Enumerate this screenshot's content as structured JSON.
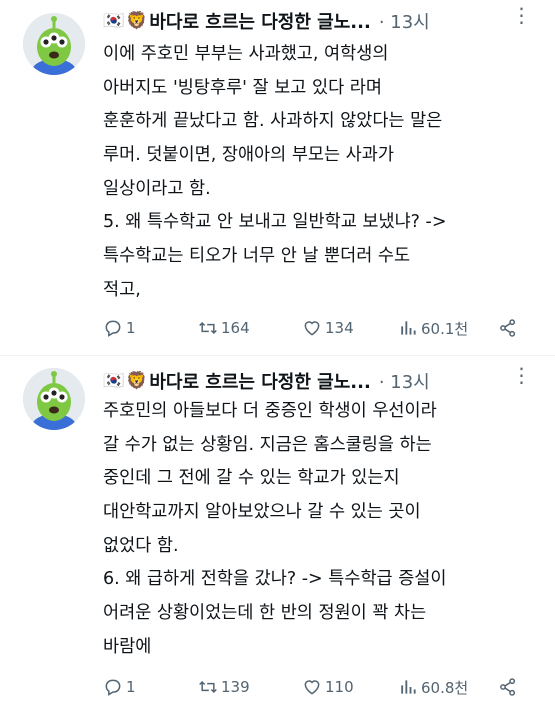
{
  "tweets": [
    {
      "author_flag": "🇰🇷",
      "author_emoji": "🦁",
      "author_name": "바다로 흐르는 다정한 글노...",
      "time": "· 13시",
      "lines": [
        "이에 주호민 부부는 사과했고, 여학생의",
        "아버지도 '빙탕후루' 잘 보고 있다 라며",
        "훈훈하게 끝났다고 함. 사과하지 않았다는 말은",
        "루머. 덧붙이면, 장애아의 부모는 사과가",
        "일상이라고 함.",
        "5. 왜 특수학교 안 보내고 일반학교 보냈냐? ->",
        "특수학교는 티오가 너무 안 날 뿐더러 수도",
        "적고,"
      ],
      "replies": "1",
      "retweets": "164",
      "likes": "134",
      "views": "60.1천"
    },
    {
      "author_flag": "🇰🇷",
      "author_emoji": "🦁",
      "author_name": "바다로 흐르는 다정한 글노...",
      "time": "· 13시",
      "lines": [
        "주호민의 아들보다 더 중증인 학생이 우선이라",
        "갈 수가 없는 상황임. 지금은 홈스쿨링을 하는",
        "중인데 그 전에 갈 수 있는 학교가 있는지",
        "대안학교까지 알아보았으나 갈 수 있는 곳이",
        "없었다 함.",
        "6. 왜 급하게 전학을 갔나? -> 특수학급 증설이",
        "어려운 상황이었는데 한 반의 정원이 꽉 차는",
        "바람에"
      ],
      "replies": "1",
      "retweets": "139",
      "likes": "110",
      "views": "60.8천"
    }
  ],
  "icons": {
    "more": "more-dots-icon",
    "reply": "reply-icon",
    "retweet": "retweet-icon",
    "like": "heart-icon",
    "views": "views-chart-icon",
    "share": "share-icon"
  },
  "colors": {
    "text": "#0f1419",
    "secondary": "#536471",
    "divider": "#eff3f4",
    "avatar_green": "#7ec843"
  }
}
